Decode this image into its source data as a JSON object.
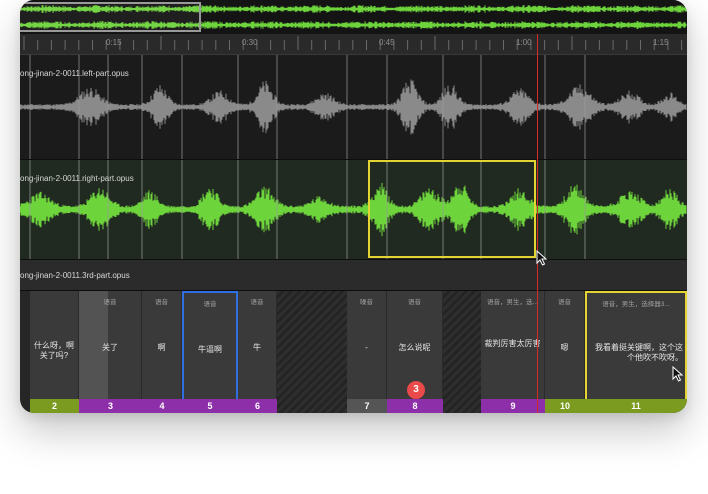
{
  "ruler": {
    "ticks": [
      "0:15",
      "0:30",
      "0:45",
      "1:00",
      "1:15"
    ]
  },
  "tracks": {
    "left": {
      "label": "ong-jinan-2-0011.left-part.opus"
    },
    "right": {
      "label": "ong-jinan-2-0011.right-part.opus"
    },
    "third": {
      "label": "ong-jinan-2-0011.3rd-part.opus"
    }
  },
  "segments": [
    {
      "id": "2",
      "tag": "",
      "text": "什么呀，啊关了吗?",
      "footer_color": "#7a9a20"
    },
    {
      "id": "3",
      "tag": "语音",
      "text": "关了",
      "footer_color": "#8d2fa8"
    },
    {
      "id": "4",
      "tag": "语音",
      "text": "啊",
      "footer_color": "#8d2fa8"
    },
    {
      "id": "5",
      "tag": "语音",
      "text": "牛逼啊",
      "footer_color": "#8d2fa8"
    },
    {
      "id": "6",
      "tag": "语音",
      "text": "牛",
      "footer_color": "#8d2fa8"
    },
    {
      "id": "7",
      "tag": "噪音",
      "text": "-",
      "footer_color": "#555555"
    },
    {
      "id": "8",
      "tag": "语音",
      "text": "怎么说呢",
      "footer_color": "#8d2fa8"
    },
    {
      "id": "9",
      "tag": "语音，男生，选...",
      "text": "裁判厉害太厉害",
      "footer_color": "#8d2fa8"
    },
    {
      "id": "10",
      "tag": "语音",
      "text": "嗯",
      "footer_color": "#7a9a20"
    },
    {
      "id": "11",
      "tag": "语音，男生，选择器3...",
      "text": "我看着挺关键啊，这个这个他吹不吹呀。",
      "footer_color": "#7a9a20"
    }
  ],
  "badge": {
    "count": "3"
  },
  "colors": {
    "wave_green": "#6ed43c",
    "wave_gray": "#8a8a8a",
    "playhead": "#d62a2a",
    "selection_yellow": "#e3d431",
    "selection_blue": "#2f6fe0"
  }
}
